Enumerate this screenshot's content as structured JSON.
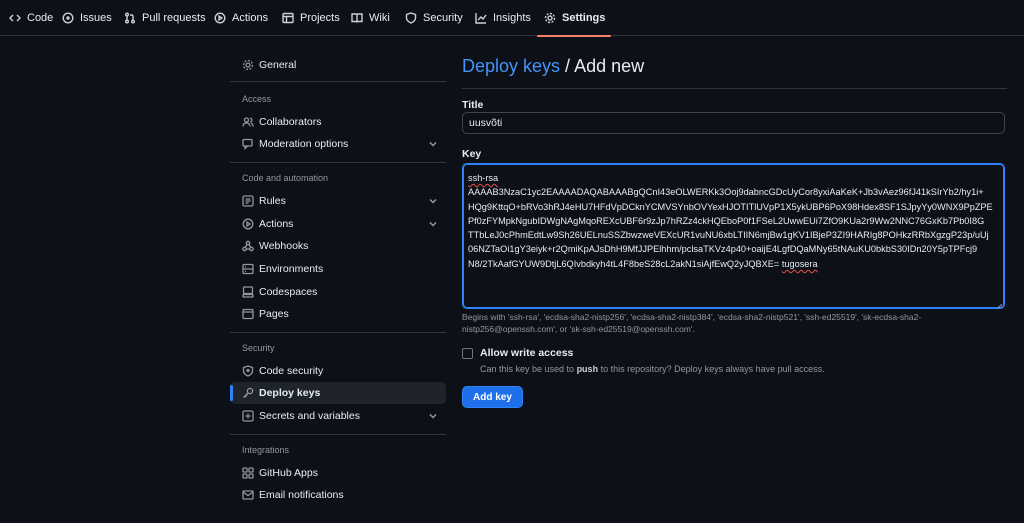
{
  "nav": {
    "tabs": [
      {
        "label": "Code",
        "icon": "code-icon"
      },
      {
        "label": "Issues",
        "icon": "issue-icon"
      },
      {
        "label": "Pull requests",
        "icon": "pull-request-icon"
      },
      {
        "label": "Actions",
        "icon": "play-icon"
      },
      {
        "label": "Projects",
        "icon": "table-icon"
      },
      {
        "label": "Wiki",
        "icon": "book-icon"
      },
      {
        "label": "Security",
        "icon": "shield-icon"
      },
      {
        "label": "Insights",
        "icon": "graph-icon"
      },
      {
        "label": "Settings",
        "icon": "gear-icon",
        "active": true
      }
    ]
  },
  "sidebar": {
    "general": "General",
    "sections": {
      "access": "Access",
      "code_automation": "Code and automation",
      "security": "Security",
      "integrations": "Integrations"
    },
    "items": {
      "collaborators": "Collaborators",
      "moderation": "Moderation options",
      "rules": "Rules",
      "actions": "Actions",
      "webhooks": "Webhooks",
      "environments": "Environments",
      "codespaces": "Codespaces",
      "pages": "Pages",
      "code_security": "Code security",
      "deploy_keys": "Deploy keys",
      "secrets": "Secrets and variables",
      "github_apps": "GitHub Apps",
      "email_notifications": "Email notifications"
    }
  },
  "main": {
    "breadcrumb_link": "Deploy keys",
    "breadcrumb_sep": " / ",
    "breadcrumb_current": "Add new",
    "title_label": "Title",
    "title_value": "uusvõti",
    "key_label": "Key",
    "key_lines": [
      "ssh-rsa",
      "AAAAB3NzaC1yc2EAAAADAQABAAABgQCnI43eOLWERKk3Ooj9dabncGDcUyCor8yxiAaKeK+Jb3vAez96fJ41kSIrYb2/hy1i+",
      "HQg9KttqO+bRVo3hRJ4eHU7HFdVpDCknYCMVSYnbOVYexHJOTITlUVpP1X5ykUBP6PoX98Hdex8SF1SJpyYy0WNX9PpZPE",
      "Pf0zFYMpkNgubIDWgNAgMqoREXcUBF6r9zJp7hRZz4ckHQEboP0f1FSeL2UwwEUi7ZfO9KUa2r9Ww2NNC76GxKb7Pb0I8G",
      "TTbLeJ0cPhmEdtLw9Sh26UELnuSSZbwzweVEXcUR1vuNU6xbLTIIN6mjBw1gKV1IBjeP3ZI9HARIg8POHkzRRbXgzgP23p/uUj",
      "06NZTaOi1gY3eiyk+r2QmiKpAJsDhH9MfJJPElhhm/pclsaTKVz4p40+oaijE4LgfDQaMNy65tNAuKU0bkbS30IDn20Y5pTPFcj9",
      "N8/2TkAafGYUW9DtjL6QIvbdkyh4tL4F8beS28cL2akN1siAjfEwQ2yJQBXE="
    ],
    "key_suffix": "tugosera",
    "key_note": "Begins with 'ssh-rsa', 'ecdsa-sha2-nistp256', 'ecdsa-sha2-nistp384', 'ecdsa-sha2-nistp521', 'ssh-ed25519', 'sk-ecdsa-sha2-nistp256@openssh.com', or 'sk-ssh-ed25519@openssh.com'.",
    "write_access_label": "Allow write access",
    "write_help_pre": "Can this key be used to ",
    "write_help_bold": "push",
    "write_help_post": " to this repository? Deploy keys always have pull access.",
    "submit_label": "Add key"
  },
  "colors": {
    "background": "#0d1117",
    "accent": "#2f81f7",
    "link": "#4493f8",
    "active_tab_underline": "#f78166",
    "primary_button": "#1f6feb"
  }
}
